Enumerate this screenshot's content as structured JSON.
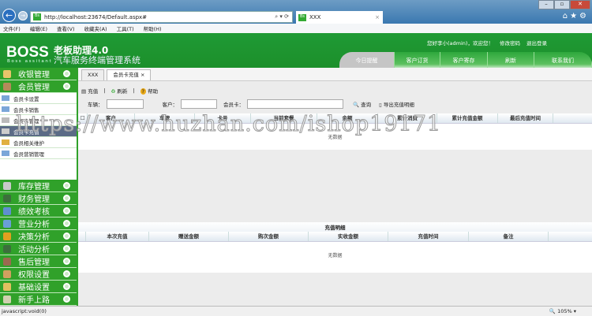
{
  "browser": {
    "url": "http://localhost:23674/Default.aspx#",
    "tab_title": "XXX",
    "tab_close": "×",
    "menu": [
      "文件(F)",
      "编辑(E)",
      "查看(V)",
      "收藏夹(A)",
      "工具(T)",
      "帮助(H)"
    ],
    "status": "javascript:void(0)",
    "zoom": "105%"
  },
  "header": {
    "logo": "BOSS",
    "logo_sub": "Boss assitant",
    "product": "老板助理4.0",
    "subtitle": "汽车服务终端管理系统",
    "welcome": "您好李小(admin)，欢迎您！",
    "change_pwd": "修改密码",
    "logout": "退出登录",
    "tabs": [
      "今日提醒",
      "客户订货",
      "客户寄存",
      "刷新",
      "联系我们"
    ]
  },
  "sidebar": {
    "top_groups": [
      "收银管理",
      "会员管理"
    ],
    "sub_items": [
      "会员卡设置",
      "会员卡销售",
      "会员卡管理",
      "会员卡充值",
      "会员相关维护",
      "会员营销管理"
    ],
    "groups": [
      "库存管理",
      "财务管理",
      "绩效考核",
      "营业分析",
      "决策分析",
      "活动分析",
      "售后管理",
      "权限设置",
      "基础设置",
      "新手上路"
    ]
  },
  "content": {
    "tabs": [
      "XXX",
      "会员卡充值"
    ],
    "toolbar": [
      "充值",
      "刷新",
      "帮助"
    ],
    "search": {
      "plate_label": "车辆：",
      "customer_label": "客户：",
      "card_label": "会员卡：",
      "query": "查询",
      "export": "导出充值明细"
    },
    "grid1": {
      "columns": [
        "客户",
        "车牌",
        "卡号",
        "当前套餐",
        "余额",
        "累计消费",
        "累计充值金额",
        "最后充值时间"
      ],
      "empty": "无数据"
    },
    "grid2": {
      "title": "充值明细",
      "columns": [
        "本次充值",
        "赠送金额",
        "购次金额",
        "实收金额",
        "充值时间",
        "备注"
      ],
      "empty": "无数据"
    }
  },
  "watermark": "https://www.huzhan.com/ishop19171"
}
